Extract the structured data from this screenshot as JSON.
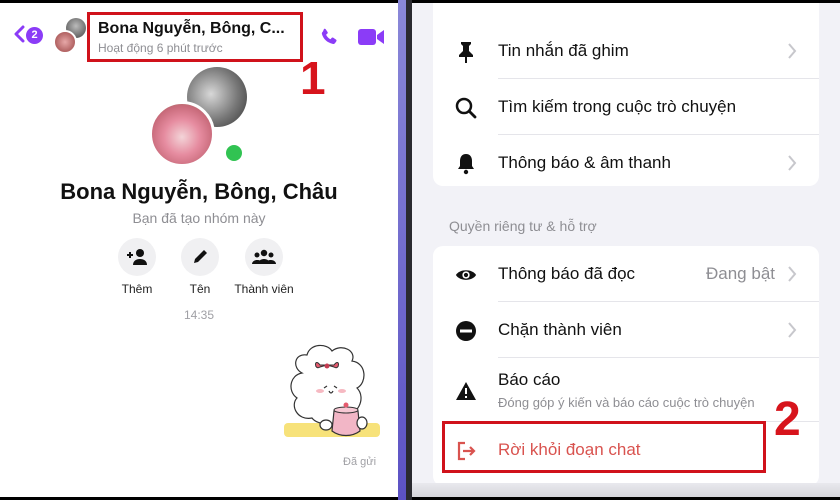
{
  "left_panel": {
    "header": {
      "unread_badge": "2",
      "title": "Bona Nguyễn, Bông, C...",
      "subtitle": "Hoạt động 6 phút trước",
      "icons": [
        "back-chevron-icon",
        "phone-icon",
        "video-camera-icon"
      ]
    },
    "group": {
      "name": "Bona Nguyễn, Bông, Châu",
      "subtitle": "Bạn đã tạo nhóm này",
      "online": true
    },
    "actions": [
      {
        "label": "Thêm",
        "icon": "add-person-icon"
      },
      {
        "label": "Tên",
        "icon": "pencil-icon"
      },
      {
        "label": "Thành viên",
        "icon": "members-icon"
      }
    ],
    "timestamp": "14:35",
    "message_status": "Đã gửi",
    "annotation_number": "1"
  },
  "right_panel": {
    "section1": [
      {
        "label": "Tin nhắn đã ghim",
        "icon": "pin-icon",
        "chevron": true
      },
      {
        "label": "Tìm kiếm trong cuộc trò chuyện",
        "icon": "search-icon",
        "chevron": false
      },
      {
        "label": "Thông báo & âm thanh",
        "icon": "bell-icon",
        "chevron": true
      }
    ],
    "section2_title": "Quyền riêng tư & hỗ trợ",
    "section2": [
      {
        "label": "Thông báo đã đọc",
        "value": "Đang bật",
        "icon": "eye-icon",
        "chevron": true
      },
      {
        "label": "Chặn thành viên",
        "icon": "block-icon",
        "chevron": true
      },
      {
        "label": "Báo cáo",
        "sublabel": "Đóng góp ý kiến và báo cáo cuộc trò chuyện",
        "icon": "warning-icon"
      },
      {
        "label": "Rời khỏi đoạn chat",
        "icon": "leave-icon",
        "color": "#d9534f"
      }
    ],
    "annotation_number": "2"
  },
  "colors": {
    "accent": "#8b3cf7",
    "highlight": "#d0121b",
    "online": "#31c352",
    "danger": "#d9534f"
  }
}
